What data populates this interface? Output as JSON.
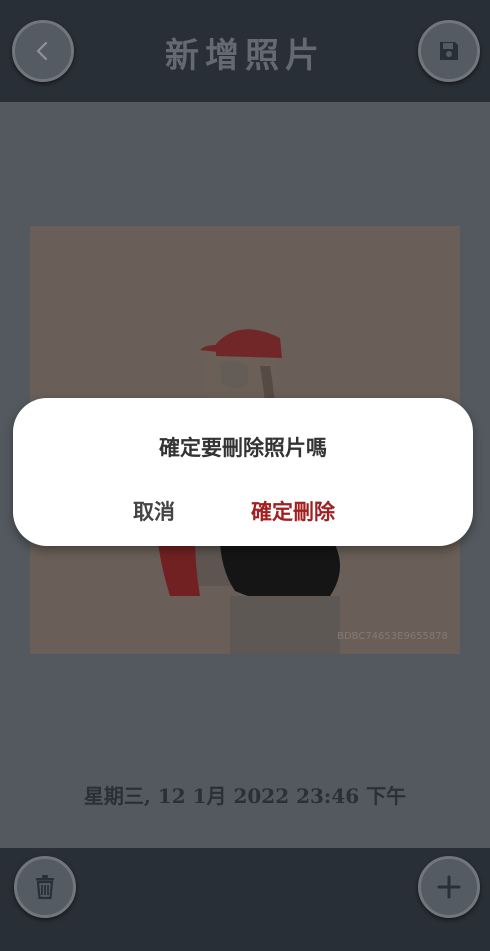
{
  "header": {
    "title": "新增照片"
  },
  "photo": {
    "watermark": "BDBC74653E9655878"
  },
  "meta": {
    "date_text": "星期三, 12 1月 2022 23:46 下午"
  },
  "dialog": {
    "message": "確定要刪除照片嗎",
    "cancel_label": "取消",
    "confirm_label": "確定刪除"
  },
  "colors": {
    "confirm": "#a11f1f",
    "bar": "#2d333b",
    "background": "#5b6168"
  },
  "icons": {
    "back": "chevron-left-icon",
    "save": "save-icon",
    "delete": "trash-icon",
    "add": "plus-icon"
  }
}
